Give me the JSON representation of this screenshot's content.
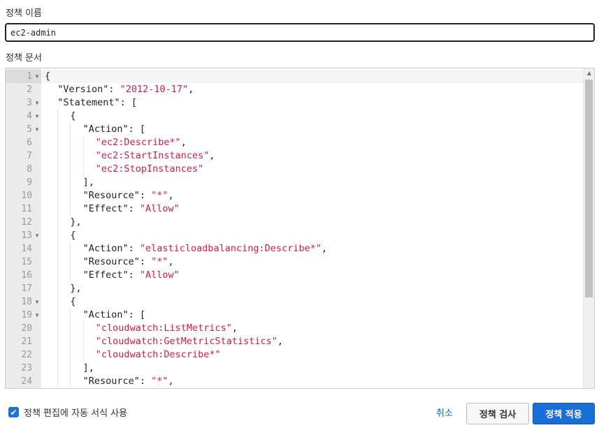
{
  "policy_name": {
    "label": "정책 이름",
    "value": "ec2-admin"
  },
  "policy_document": {
    "label": "정책 문서",
    "lines": [
      {
        "n": "1",
        "fold": true,
        "indent": 0,
        "parts": [
          [
            "p",
            "{"
          ]
        ]
      },
      {
        "n": "2",
        "fold": false,
        "indent": 1,
        "parts": [
          [
            "p",
            "\"Version\": "
          ],
          [
            "s",
            "\"2012-10-17\""
          ],
          [
            "p",
            ","
          ]
        ]
      },
      {
        "n": "3",
        "fold": true,
        "indent": 1,
        "parts": [
          [
            "p",
            "\"Statement\": ["
          ]
        ]
      },
      {
        "n": "4",
        "fold": true,
        "indent": 2,
        "parts": [
          [
            "p",
            "{"
          ]
        ]
      },
      {
        "n": "5",
        "fold": true,
        "indent": 3,
        "parts": [
          [
            "p",
            "\"Action\": ["
          ]
        ]
      },
      {
        "n": "6",
        "fold": false,
        "indent": 4,
        "parts": [
          [
            "s",
            "\"ec2:Describe*\""
          ],
          [
            "p",
            ","
          ]
        ]
      },
      {
        "n": "7",
        "fold": false,
        "indent": 4,
        "parts": [
          [
            "s",
            "\"ec2:StartInstances\""
          ],
          [
            "p",
            ","
          ]
        ]
      },
      {
        "n": "8",
        "fold": false,
        "indent": 4,
        "parts": [
          [
            "s",
            "\"ec2:StopInstances\""
          ]
        ]
      },
      {
        "n": "9",
        "fold": false,
        "indent": 3,
        "parts": [
          [
            "p",
            "],"
          ]
        ]
      },
      {
        "n": "10",
        "fold": false,
        "indent": 3,
        "parts": [
          [
            "p",
            "\"Resource\": "
          ],
          [
            "s",
            "\"*\""
          ],
          [
            "p",
            ","
          ]
        ]
      },
      {
        "n": "11",
        "fold": false,
        "indent": 3,
        "parts": [
          [
            "p",
            "\"Effect\": "
          ],
          [
            "s",
            "\"Allow\""
          ]
        ]
      },
      {
        "n": "12",
        "fold": false,
        "indent": 2,
        "parts": [
          [
            "p",
            "},"
          ]
        ]
      },
      {
        "n": "13",
        "fold": true,
        "indent": 2,
        "parts": [
          [
            "p",
            "{"
          ]
        ]
      },
      {
        "n": "14",
        "fold": false,
        "indent": 3,
        "parts": [
          [
            "p",
            "\"Action\": "
          ],
          [
            "s",
            "\"elasticloadbalancing:Describe*\""
          ],
          [
            "p",
            ","
          ]
        ]
      },
      {
        "n": "15",
        "fold": false,
        "indent": 3,
        "parts": [
          [
            "p",
            "\"Resource\": "
          ],
          [
            "s",
            "\"*\""
          ],
          [
            "p",
            ","
          ]
        ]
      },
      {
        "n": "16",
        "fold": false,
        "indent": 3,
        "parts": [
          [
            "p",
            "\"Effect\": "
          ],
          [
            "s",
            "\"Allow\""
          ]
        ]
      },
      {
        "n": "17",
        "fold": false,
        "indent": 2,
        "parts": [
          [
            "p",
            "},"
          ]
        ]
      },
      {
        "n": "18",
        "fold": true,
        "indent": 2,
        "parts": [
          [
            "p",
            "{"
          ]
        ]
      },
      {
        "n": "19",
        "fold": true,
        "indent": 3,
        "parts": [
          [
            "p",
            "\"Action\": ["
          ]
        ]
      },
      {
        "n": "20",
        "fold": false,
        "indent": 4,
        "parts": [
          [
            "s",
            "\"cloudwatch:ListMetrics\""
          ],
          [
            "p",
            ","
          ]
        ]
      },
      {
        "n": "21",
        "fold": false,
        "indent": 4,
        "parts": [
          [
            "s",
            "\"cloudwatch:GetMetricStatistics\""
          ],
          [
            "p",
            ","
          ]
        ]
      },
      {
        "n": "22",
        "fold": false,
        "indent": 4,
        "parts": [
          [
            "s",
            "\"cloudwatch:Describe*\""
          ]
        ]
      },
      {
        "n": "23",
        "fold": false,
        "indent": 3,
        "parts": [
          [
            "p",
            "],"
          ]
        ]
      },
      {
        "n": "24",
        "fold": false,
        "indent": 3,
        "parts": [
          [
            "p",
            "\"Resource\": "
          ],
          [
            "s",
            "\"*\""
          ],
          [
            "p",
            ","
          ]
        ]
      }
    ]
  },
  "footer": {
    "autoformat_label": "정책 편집에 자동 서식 사용",
    "autoformat_checked": true,
    "cancel_label": "취소",
    "review_label": "정책 검사",
    "apply_label": "정책 적용"
  },
  "colors": {
    "string": "#d01b47",
    "primary": "#1a6ed8",
    "link": "#0a66c2"
  },
  "icons": {
    "fold": "fold-arrow-icon",
    "check": "checkmark-icon",
    "scroll_up": "scroll-up-arrow-icon"
  }
}
